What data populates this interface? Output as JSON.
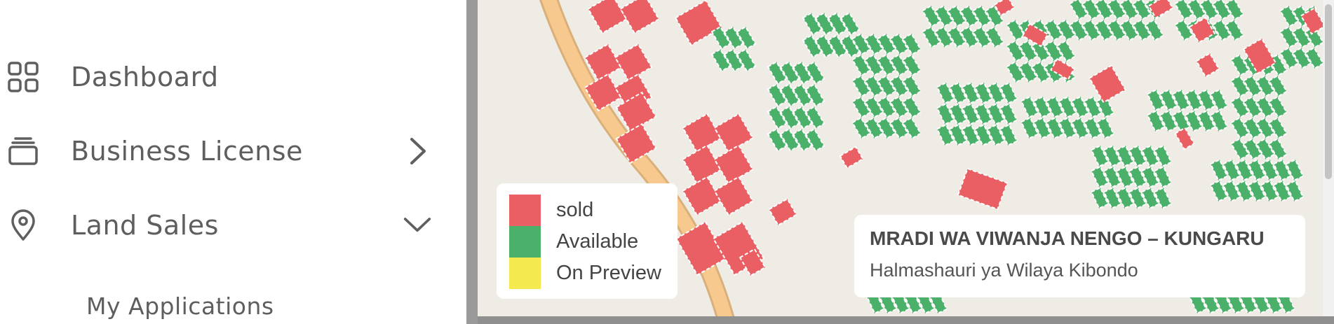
{
  "sidebar": {
    "items": [
      {
        "label": "Dashboard",
        "icon": "grid-icon"
      },
      {
        "label": "Business License",
        "icon": "cards-icon",
        "chevron": "chevron-right-icon"
      },
      {
        "label": "Land Sales",
        "icon": "location-pin-icon",
        "chevron": "chevron-down-icon"
      }
    ],
    "subitems": [
      {
        "label": "My Applications"
      }
    ]
  },
  "map": {
    "legend": [
      {
        "label": "sold",
        "color": "#e95f63"
      },
      {
        "label": "Available",
        "color": "#4bb06a"
      },
      {
        "label": "On Preview",
        "color": "#f4e94e"
      }
    ],
    "info": {
      "title": "MRADI WA VIWANJA NENGO – KUNGARU",
      "subtitle": "Halmashauri ya Wilaya Kibondo"
    },
    "colors": {
      "background": "#efebe5",
      "road": "#f7c98e",
      "sold": "#e95f63",
      "available": "#4bb06a"
    }
  }
}
